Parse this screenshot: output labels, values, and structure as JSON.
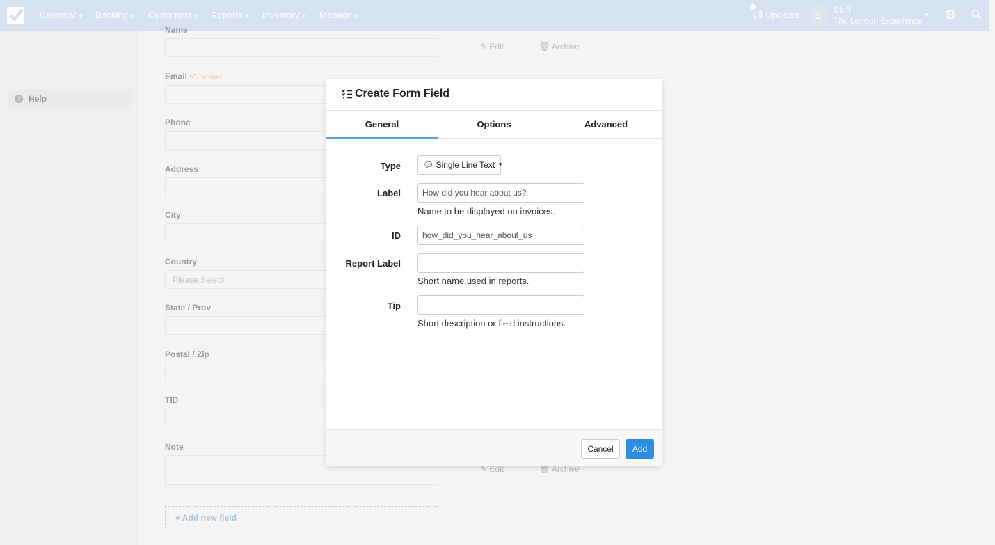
{
  "nav": {
    "items": [
      {
        "label": "Calendar"
      },
      {
        "label": "Booking"
      },
      {
        "label": "Customers"
      },
      {
        "label": "Reports"
      },
      {
        "label": "Inventory"
      },
      {
        "label": "Manage"
      }
    ],
    "updates_label": "Updates",
    "avatar_initial": "S",
    "staff_role": "Staff",
    "staff_org": "The London Experience"
  },
  "sidebar": {
    "help_label": "Help"
  },
  "form": {
    "fields": [
      {
        "label": "Name"
      },
      {
        "label": "Email",
        "required_note": "Customer"
      },
      {
        "label": "Phone"
      },
      {
        "label": "Address"
      },
      {
        "label": "City"
      },
      {
        "label": "Country",
        "placeholder": "Please Select"
      },
      {
        "label": "State / Prov"
      },
      {
        "label": "Postal / Zip"
      },
      {
        "label": "TID"
      },
      {
        "label": "Note"
      }
    ],
    "edit_label": "Edit",
    "archive_label": "Archive",
    "add_field_label": "+ Add new field"
  },
  "modal": {
    "title": "Create Form Field",
    "tabs": [
      {
        "label": "General",
        "active": true
      },
      {
        "label": "Options",
        "active": false
      },
      {
        "label": "Advanced",
        "active": false
      }
    ],
    "type_label": "Type",
    "type_value": "Single Line Text",
    "label_label": "Label",
    "label_value": "How did you hear about us?",
    "label_help": "Name to be displayed on invoices.",
    "id_label": "ID",
    "id_value": "how_did_you_hear_about_us",
    "report_label_label": "Report Label",
    "report_label_value": "",
    "report_label_help": "Short name used in reports.",
    "tip_label": "Tip",
    "tip_value": "",
    "tip_help": "Short description or field instructions.",
    "cancel_label": "Cancel",
    "add_label": "Add"
  },
  "colors": {
    "nav_bg": "#d6e2ef",
    "primary": "#2d8ce3",
    "tab_active": "#5aa0dc"
  }
}
